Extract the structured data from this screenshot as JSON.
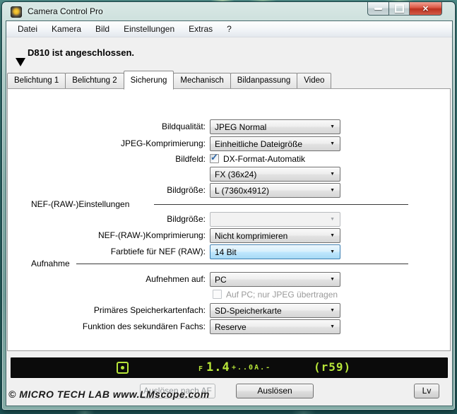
{
  "window": {
    "title": "Camera Control Pro"
  },
  "menu": {
    "items": [
      "Datei",
      "Kamera",
      "Bild",
      "Einstellungen",
      "Extras",
      "?"
    ]
  },
  "status": {
    "connection": "D810 ist angeschlossen."
  },
  "tabs": [
    {
      "label": "Belichtung 1"
    },
    {
      "label": "Belichtung 2"
    },
    {
      "label": "Sicherung"
    },
    {
      "label": "Mechanisch"
    },
    {
      "label": "Bildanpassung"
    },
    {
      "label": "Video"
    }
  ],
  "form": {
    "bildqualitaet": {
      "label": "Bildqualität:",
      "value": "JPEG Normal"
    },
    "jpeg_komprimierung": {
      "label": "JPEG-Komprimierung:",
      "value": "Einheitliche Dateigröße"
    },
    "bildfeld": {
      "label": "Bildfeld:",
      "checkbox_label": "DX-Format-Automatik",
      "checked": true
    },
    "format": {
      "value": "FX (36x24)"
    },
    "bildgroesse": {
      "label": "Bildgröße:",
      "value": "L (7360x4912)"
    },
    "nef_section_label": "NEF-(RAW-)Einstellungen",
    "nef_bildgroesse": {
      "label": "Bildgröße:",
      "value": ""
    },
    "nef_komprimierung": {
      "label": "NEF-(RAW-)Komprimierung:",
      "value": "Nicht komprimieren"
    },
    "farbtiefe": {
      "label": "Farbtiefe für NEF (RAW):",
      "value": "14 Bit"
    },
    "aufnahme_section_label": "Aufnahme",
    "aufnehmen_auf": {
      "label": "Aufnehmen auf:",
      "value": "PC"
    },
    "auf_pc_jpeg": {
      "label": "Auf PC; nur JPEG übertragen",
      "checked": false
    },
    "primaeres_fach": {
      "label": "Primäres Speicherkartenfach:",
      "value": "SD-Speicherkarte"
    },
    "sekundaeres_fach": {
      "label": "Funktion des sekundären Fachs:",
      "value": "Reserve"
    }
  },
  "lcd": {
    "metering_icon": "matrix-metering",
    "aperture_prefix": "F",
    "aperture": "1.4",
    "meter_scale": "+..0A.-",
    "buffer": "(r59)"
  },
  "buttons": {
    "af_release": "Auslösen nach AF",
    "release": "Auslösen",
    "lv": "Lv"
  },
  "footer": {
    "text": "© MICRO TECH LAB  www.LMscope.com"
  },
  "icons": {
    "combo_arrow": "▼",
    "close": "✕",
    "check": "✓"
  },
  "colors": {
    "desktop_teal": "#2e6b6d",
    "glass_border": "#84aca6",
    "lcd_green": "#b7e539",
    "close_red": "#bd3220",
    "hover_combo_border": "#3c7fb1",
    "hover_combo_fill": "#bee6fd"
  }
}
